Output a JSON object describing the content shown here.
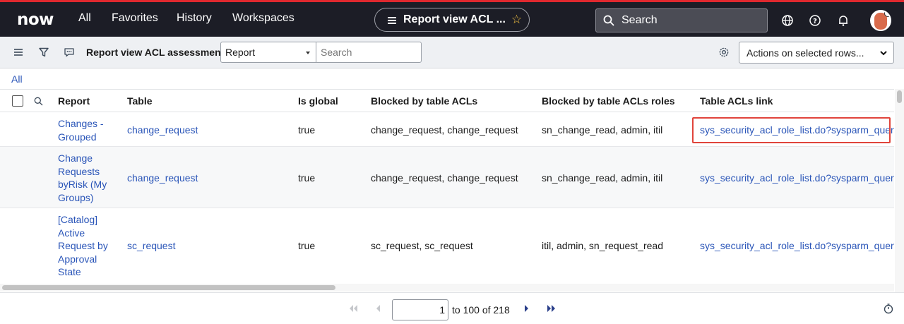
{
  "nav": {
    "logo": "now",
    "links": [
      "All",
      "Favorites",
      "History",
      "Workspaces"
    ],
    "context_title": "Report view ACL ...",
    "search_placeholder": "Search"
  },
  "listbar": {
    "title": "Report view ACL assessments",
    "field_selected": "Report",
    "search_placeholder": "Search",
    "actions_label": "Actions on selected rows..."
  },
  "breadcrumb": "All",
  "table": {
    "columns": [
      "Report",
      "Table",
      "Is global",
      "Blocked by table ACLs",
      "Blocked by table ACLs roles",
      "Table ACLs link"
    ],
    "rows": [
      {
        "report": "Changes - Grouped",
        "table": "change_request",
        "is_global": "true",
        "blocked": "change_request, change_request",
        "roles": "sn_change_read, admin, itil",
        "link": "sys_security_acl_role_list.do?sysparm_query="
      },
      {
        "report": "Change Requests byRisk (My Groups)",
        "table": "change_request",
        "is_global": "true",
        "blocked": "change_request, change_request",
        "roles": "sn_change_read, admin, itil",
        "link": "sys_security_acl_role_list.do?sysparm_query="
      },
      {
        "report": "[Catalog] Active Request by Approval State",
        "table": "sc_request",
        "is_global": "true",
        "blocked": "sc_request, sc_request",
        "roles": "itil, admin, sn_request_read",
        "link": "sys_security_acl_role_list.do?sysparm_query="
      }
    ]
  },
  "pager": {
    "current": "1",
    "range_text": "to 100 of 218"
  },
  "colors": {
    "topbar": "#1c1d26",
    "accent_red": "#e0282e",
    "link": "#2a55b8"
  }
}
